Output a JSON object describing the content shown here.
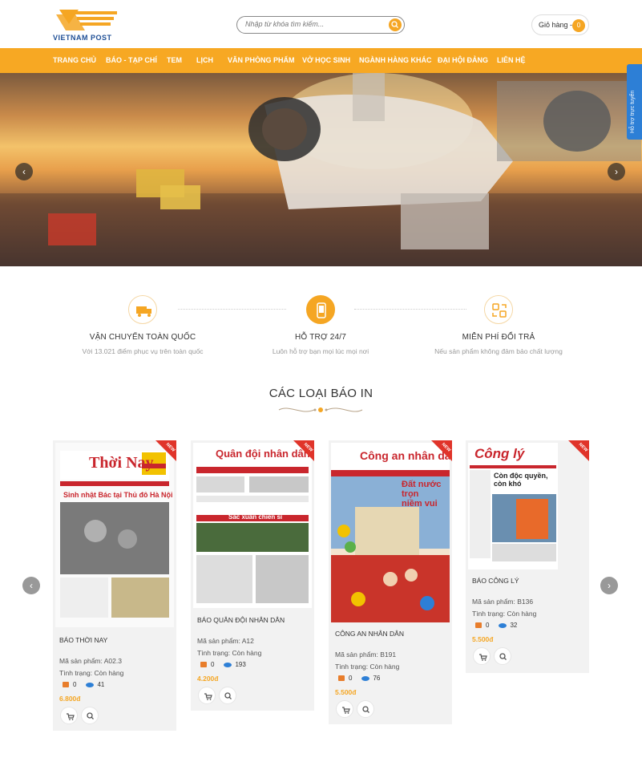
{
  "header": {
    "logo_text": "VIETNAM POST",
    "search_placeholder": "Nhập từ khóa tìm kiếm...",
    "cart_label": "Giỏ hàng -",
    "cart_count": "0",
    "brand_color": "#f7a823"
  },
  "nav": {
    "items": [
      "TRANG CHỦ",
      "BÁO - TẠP CHÍ",
      "TEM",
      "LỊCH",
      "VĂN PHÒNG PHẨM",
      "VỞ HỌC SINH",
      "NGÀNH HÀNG KHÁC",
      "ĐẠI HỘI ĐẢNG",
      "LIÊN HỆ"
    ]
  },
  "support_tab": "Hỗ trợ trực tuyến",
  "features": [
    {
      "title": "VẬN CHUYỂN TOÀN QUỐC",
      "desc": "Với 13.021 điểm phục vụ trên toàn quốc",
      "icon": "delivery-truck-icon"
    },
    {
      "title": "HỖ TRỢ 24/7",
      "desc": "Luôn hỗ trợ bạn mọi lúc mọi nơi",
      "icon": "phone-support-icon"
    },
    {
      "title": "MIỄN PHÍ ĐỔI TRẢ",
      "desc": "Nếu sản phẩm không đảm bảo chất lượng",
      "icon": "exchange-icon"
    }
  ],
  "section": {
    "title": "CÁC LOẠI BÁO IN"
  },
  "products": [
    {
      "badge": "NEW",
      "name": "BÁO THỜI NAY",
      "code": "Mã sản phẩm: A02.3",
      "status": "Tình trạng: Còn hàng",
      "likes": "0",
      "views": "41",
      "price": "6.800đ",
      "masthead": "Thời Nay",
      "headline": "Sinh nhật Bác tại Thủ đô Hà Nội"
    },
    {
      "badge": "NEW",
      "name": "BÁO QUÂN ĐỘI NHÂN DÂN",
      "code": "Mã sản phẩm: A12",
      "status": "Tình trạng: Còn hàng",
      "likes": "0",
      "views": "193",
      "price": "4.200đ",
      "masthead": "Quân đội nhân dân",
      "headline": "Sắc xuân chiến sĩ"
    },
    {
      "badge": "NEW",
      "name": "CÔNG AN NHÂN DÂN",
      "code": "Mã sản phẩm: B191",
      "status": "Tình trạng: Còn hàng",
      "likes": "0",
      "views": "76",
      "price": "5.500đ",
      "masthead": "Công an nhân dân",
      "headline": "Đất nước trọn niềm vui"
    },
    {
      "badge": "NEW",
      "name": "BÁO CÔNG LÝ",
      "code": "Mã sản phẩm: B136",
      "status": "Tình trạng: Còn hàng",
      "likes": "0",
      "views": "32",
      "price": "5.500đ",
      "masthead": "Công lý",
      "headline": "Còn độc quyền, còn khó"
    }
  ]
}
